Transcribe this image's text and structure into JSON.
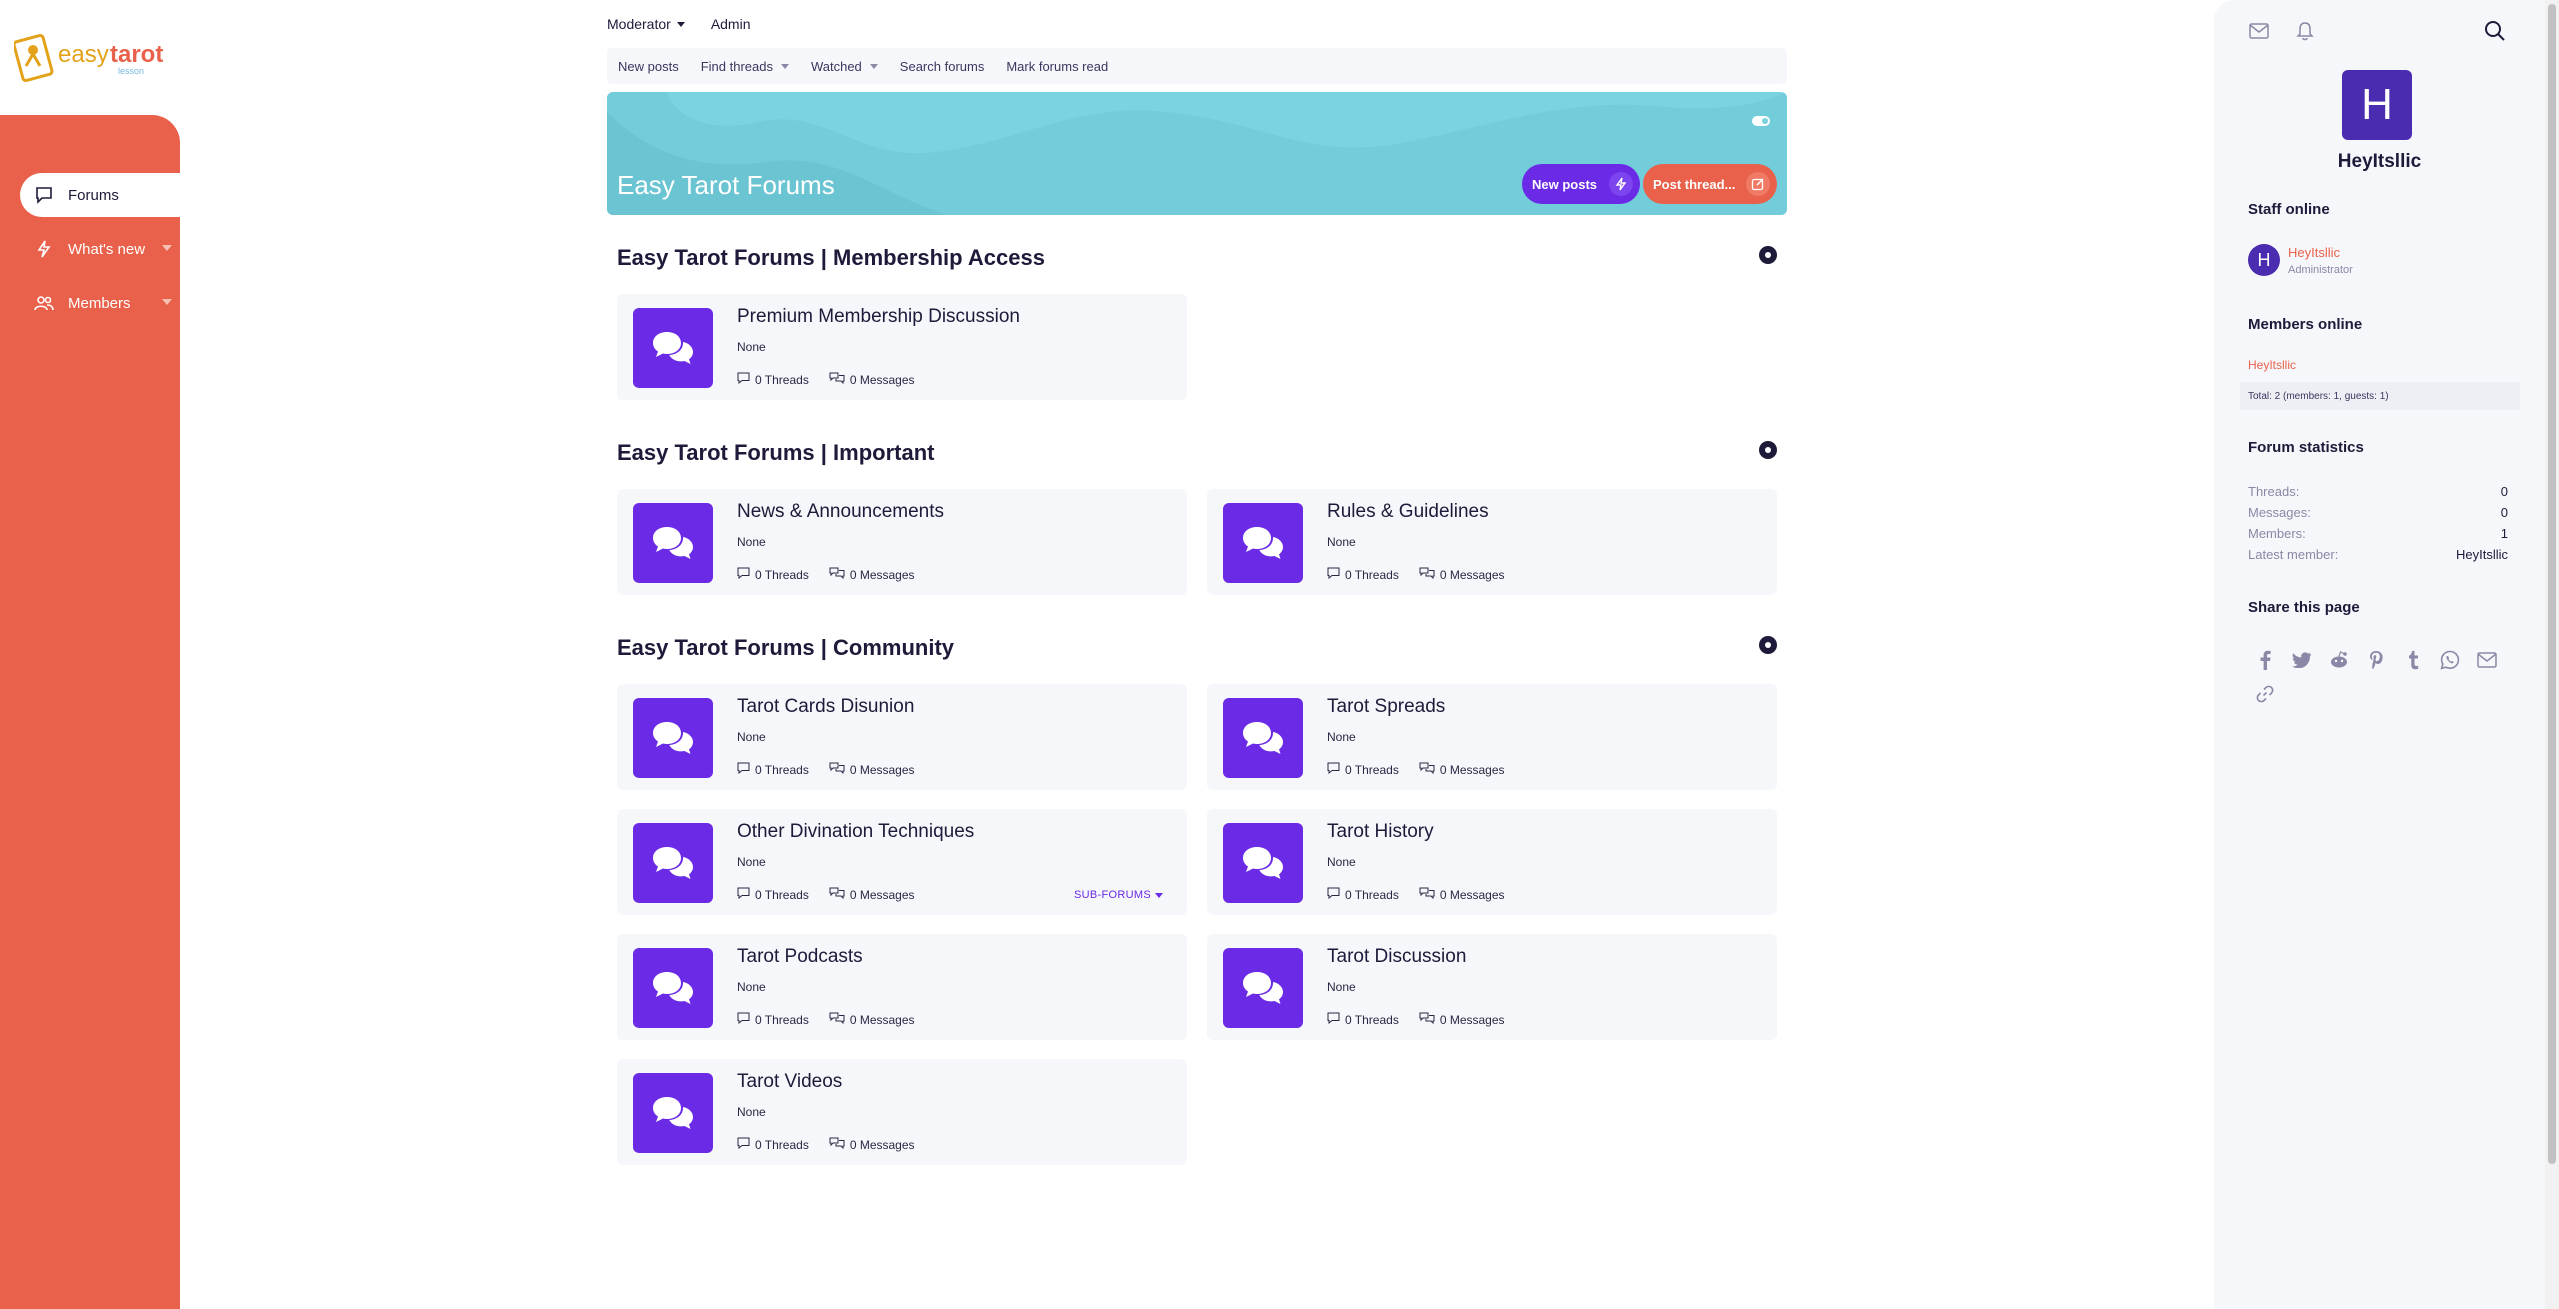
{
  "brand": {
    "logo_text_easy": "easy",
    "logo_text_tarot": "tarot",
    "logo_sub": "lesson",
    "accent": "#e9614a",
    "purple": "#6a2ae6"
  },
  "sidebar": {
    "items": [
      {
        "label": "Forums",
        "icon": "forum-icon"
      },
      {
        "label": "What's new",
        "icon": "bolt-icon"
      },
      {
        "label": "Members",
        "icon": "users-icon"
      }
    ]
  },
  "topnav": {
    "moderator": "Moderator",
    "admin": "Admin"
  },
  "subnav": {
    "new_posts": "New posts",
    "find_threads": "Find threads",
    "watched": "Watched",
    "search_forums": "Search forums",
    "mark_read": "Mark forums read"
  },
  "banner": {
    "title": "Easy Tarot Forums",
    "new_posts": "New posts",
    "post_thread": "Post thread..."
  },
  "sections": [
    {
      "title": "Easy Tarot Forums | Membership Access",
      "forums": [
        {
          "title": "Premium Membership Discussion",
          "desc": "None",
          "threads": "0 Threads",
          "messages": "0 Messages"
        }
      ]
    },
    {
      "title": "Easy Tarot Forums | Important",
      "forums": [
        {
          "title": "News & Announcements",
          "desc": "None",
          "threads": "0 Threads",
          "messages": "0 Messages"
        },
        {
          "title": "Rules & Guidelines",
          "desc": "None",
          "threads": "0 Threads",
          "messages": "0 Messages"
        }
      ]
    },
    {
      "title": "Easy Tarot Forums | Community",
      "forums": [
        {
          "title": "Tarot Cards Disunion",
          "desc": "None",
          "threads": "0 Threads",
          "messages": "0 Messages"
        },
        {
          "title": "Tarot Spreads",
          "desc": "None",
          "threads": "0 Threads",
          "messages": "0 Messages"
        },
        {
          "title": "Other Divination Techniques",
          "desc": "None",
          "threads": "0 Threads",
          "messages": "0 Messages",
          "subforums": "SUB-FORUMS"
        },
        {
          "title": "Tarot History",
          "desc": "None",
          "threads": "0 Threads",
          "messages": "0 Messages"
        },
        {
          "title": "Tarot Podcasts",
          "desc": "None",
          "threads": "0 Threads",
          "messages": "0 Messages"
        },
        {
          "title": "Tarot Discussion",
          "desc": "None",
          "threads": "0 Threads",
          "messages": "0 Messages"
        },
        {
          "title": "Tarot Videos",
          "desc": "None",
          "threads": "0 Threads",
          "messages": "0 Messages"
        }
      ]
    }
  ],
  "right": {
    "avatar_letter": "H",
    "username": "HeyItsllic",
    "staff_online": "Staff online",
    "staff_name": "HeyItsllic",
    "staff_role": "Administrator",
    "members_online": "Members online",
    "member_name": "HeyItsllic",
    "total": "Total: 2 (members: 1, guests: 1)",
    "forum_statistics": "Forum statistics",
    "stats": [
      {
        "k": "Threads:",
        "v": "0"
      },
      {
        "k": "Messages:",
        "v": "0"
      },
      {
        "k": "Members:",
        "v": "1"
      },
      {
        "k": "Latest member:",
        "v": "HeyItsllic"
      }
    ],
    "share_title": "Share this page",
    "share_icons": [
      "facebook-icon",
      "twitter-icon",
      "reddit-icon",
      "pinterest-icon",
      "tumblr-icon",
      "whatsapp-icon",
      "email-icon",
      "link-icon"
    ]
  }
}
